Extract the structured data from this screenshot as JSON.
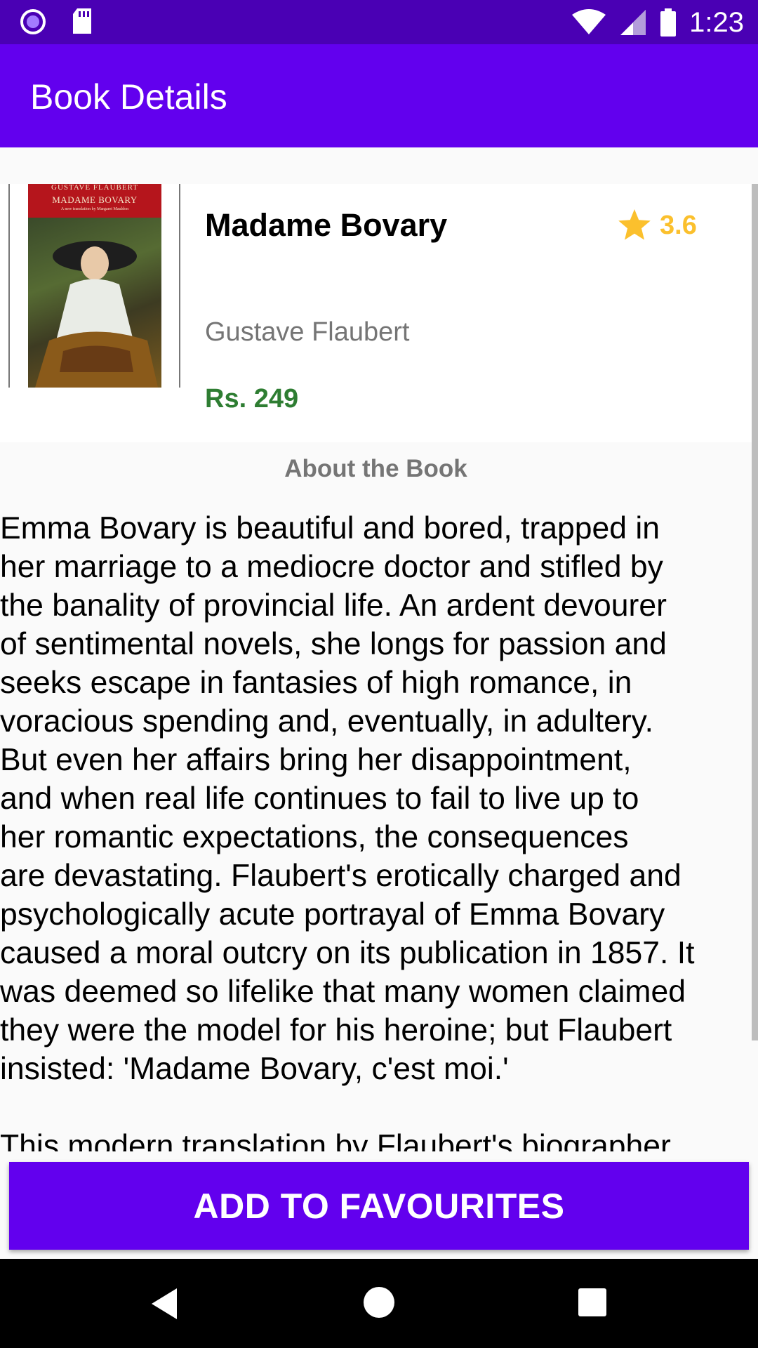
{
  "status_bar": {
    "time": "1:23",
    "icons": [
      "app-notification-icon",
      "sd-card-icon",
      "wifi-icon",
      "cell-signal-icon",
      "battery-icon"
    ]
  },
  "app_bar": {
    "title": "Book Details"
  },
  "book": {
    "cover": {
      "author_line": "GUSTAVE FLAUBERT",
      "title_line": "MADAME BOVARY",
      "subtitle_line": "A new translation by Margaret Mauldon"
    },
    "title": "Madame Bovary",
    "rating": "3.6",
    "author": "Gustave Flaubert",
    "price": "Rs. 249"
  },
  "about": {
    "heading": "About the Book",
    "description": "Emma Bovary is beautiful and bored, trapped in\nher marriage to a mediocre doctor and stifled by\nthe banality of provincial life. An ardent devourer\nof sentimental novels, she longs for passion and\nseeks escape in fantasies of high romance, in\nvoracious spending and, eventually, in adultery.\nBut even her affairs bring her disappointment,\nand when real life continues to fail to live up to\nher romantic expectations, the consequences\nare devastating. Flaubert's erotically charged and\npsychologically acute portrayal of Emma Bovary\ncaused a moral outcry on its publication in 1857. It\nwas deemed so lifelike that many women claimed\nthey were the model for his heroine; but Flaubert\ninsisted: 'Madame Bovary, c'est moi.'\n\nThis modern translation by Flaubert's biographer"
  },
  "actions": {
    "add_to_favourites": "ADD TO FAVOURITES"
  },
  "colors": {
    "primary": "#6200ee",
    "status_bar": "#4a00b4",
    "rating": "#fbc02d",
    "price": "#2e7d32"
  }
}
